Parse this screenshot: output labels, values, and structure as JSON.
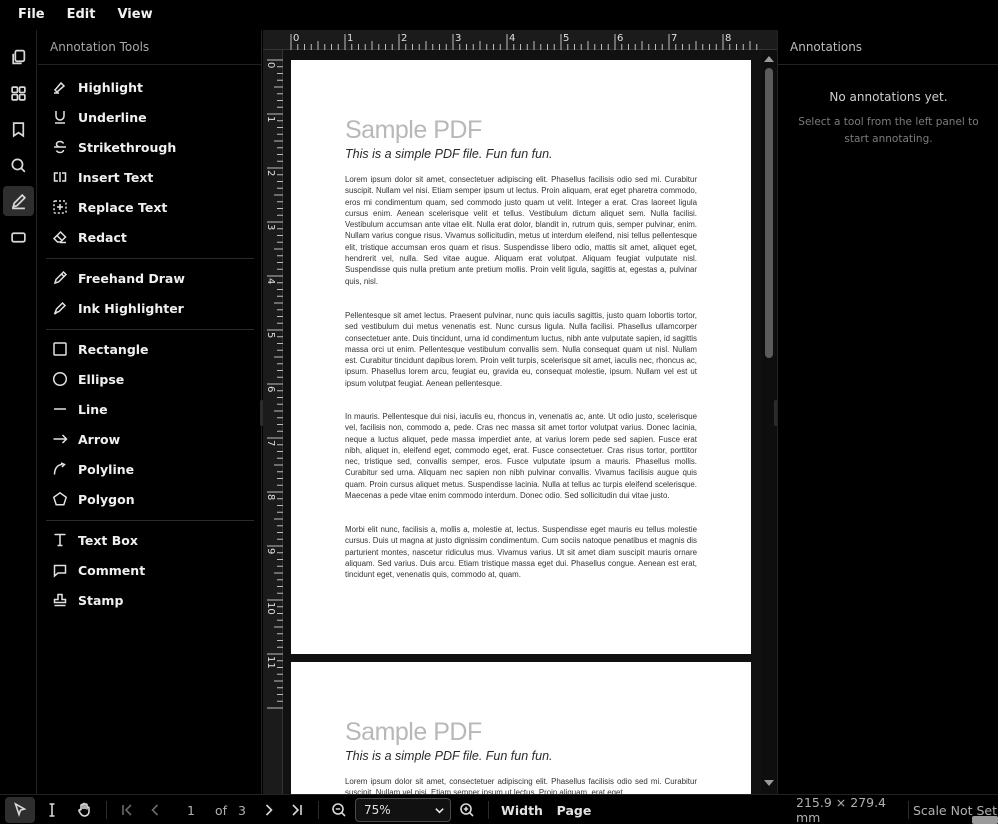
{
  "menubar": {
    "items": [
      "File",
      "Edit",
      "View"
    ]
  },
  "rail": {
    "items": [
      {
        "icon": "copy-icon",
        "active": false
      },
      {
        "icon": "grid-icon",
        "active": false
      },
      {
        "icon": "bookmark-icon",
        "active": false
      },
      {
        "icon": "search-icon",
        "active": false
      },
      {
        "icon": "pen-icon",
        "active": true
      },
      {
        "icon": "rectangle-icon",
        "active": false
      }
    ]
  },
  "tools_panel": {
    "title": "Annotation Tools",
    "groups": [
      [
        "Highlight",
        "Underline",
        "Strikethrough",
        "Insert Text",
        "Replace Text",
        "Redact"
      ],
      [
        "Freehand Draw",
        "Ink Highlighter"
      ],
      [
        "Rectangle",
        "Ellipse",
        "Line",
        "Arrow",
        "Polyline",
        "Polygon"
      ],
      [
        "Text Box",
        "Comment",
        "Stamp"
      ]
    ]
  },
  "ruler": {
    "h_labels": [
      "0",
      "1",
      "2",
      "3",
      "4",
      "5",
      "6",
      "7",
      "8"
    ],
    "v_labels": [
      "0",
      "1",
      "2",
      "3",
      "4",
      "5",
      "6",
      "7",
      "8",
      "9",
      "10",
      "11"
    ]
  },
  "document": {
    "page_title": "Sample PDF",
    "page_subtitle": "This is a simple PDF file. Fun fun fun.",
    "paragraphs": [
      "Lorem ipsum dolor sit amet, consectetuer adipiscing elit. Phasellus facilisis odio sed mi. Curabitur suscipit. Nullam vel nisi. Etiam semper ipsum ut lectus. Proin aliquam, erat eget pharetra commodo, eros mi condimentum quam, sed commodo justo quam ut velit. Integer a erat. Cras laoreet ligula cursus enim. Aenean scelerisque velit et tellus. Vestibulum dictum aliquet sem. Nulla facilisi. Vestibulum accumsan ante vitae elit. Nulla erat dolor, blandit in, rutrum quis, semper pulvinar, enim. Nullam varius congue risus. Vivamus sollicitudin, metus ut interdum eleifend, nisi tellus pellentesque elit, tristique accumsan eros quam et risus. Suspendisse libero odio, mattis sit amet, aliquet eget, hendrerit vel, nulla. Sed vitae augue. Aliquam erat volutpat. Aliquam feugiat vulputate nisl. Suspendisse quis nulla pretium ante pretium mollis. Proin velit ligula, sagittis at, egestas a, pulvinar quis, nisl.",
      "Pellentesque sit amet lectus. Praesent pulvinar, nunc quis iaculis sagittis, justo quam lobortis tortor, sed vestibulum dui metus venenatis est. Nunc cursus ligula. Nulla facilisi. Phasellus ullamcorper consectetuer ante. Duis tincidunt, urna id condimentum luctus, nibh ante vulputate sapien, id sagittis massa orci ut enim. Pellentesque vestibulum convallis sem. Nulla consequat quam ut nisl. Nullam est. Curabitur tincidunt dapibus lorem. Proin velit turpis, scelerisque sit amet, iaculis nec, rhoncus ac, ipsum. Phasellus lorem arcu, feugiat eu, gravida eu, consequat molestie, ipsum. Nullam vel est ut ipsum volutpat feugiat. Aenean pellentesque.",
      "In mauris. Pellentesque dui nisi, iaculis eu, rhoncus in, venenatis ac, ante. Ut odio justo, scelerisque vel, facilisis non, commodo a, pede. Cras nec massa sit amet tortor volutpat varius. Donec lacinia, neque a luctus aliquet, pede massa imperdiet ante, at varius lorem pede sed sapien. Fusce erat nibh, aliquet in, eleifend eget, commodo eget, erat. Fusce consectetuer. Cras risus tortor, porttitor nec, tristique sed, convallis semper, eros. Fusce vulputate ipsum a mauris. Phasellus mollis. Curabitur sed urna. Aliquam nec sapien non nibh pulvinar convallis. Vivamus facilisis augue quis quam. Proin cursus aliquet metus. Suspendisse lacinia. Nulla at tellus ac turpis eleifend scelerisque. Maecenas a pede vitae enim commodo interdum. Donec odio. Sed sollicitudin dui vitae justo.",
      "Morbi elit nunc, facilisis a, mollis a, molestie at, lectus. Suspendisse eget mauris eu tellus molestie cursus. Duis ut magna at justo dignissim condimentum. Cum sociis natoque penatibus et magnis dis parturient montes, nascetur ridiculus mus. Vivamus varius. Ut sit amet diam suscipit mauris ornare aliquam. Sed varius. Duis arcu. Etiam tristique massa eget dui. Phasellus congue. Aenean est erat, tincidunt eget, venenatis quis, commodo at, quam."
    ],
    "page2_first_line": "Lorem ipsum dolor sit amet, consectetuer adipiscing elit. Phasellus facilisis odio sed mi. Curabitur suscipit. Nullam vel nisi. Etiam semper ipsum ut lectus. Proin aliquam, erat eget"
  },
  "annotations_panel": {
    "title": "Annotations",
    "empty": "No annotations yet.",
    "hint": "Select a tool from the left panel to start annotating."
  },
  "bottombar": {
    "page_current": "1",
    "page_of": "of",
    "page_total": "3",
    "zoom": "75%",
    "fit_width": "Width",
    "fit_page": "Page",
    "dimensions": "215.9 × 279.4 mm",
    "scale": "Scale Not Set"
  }
}
